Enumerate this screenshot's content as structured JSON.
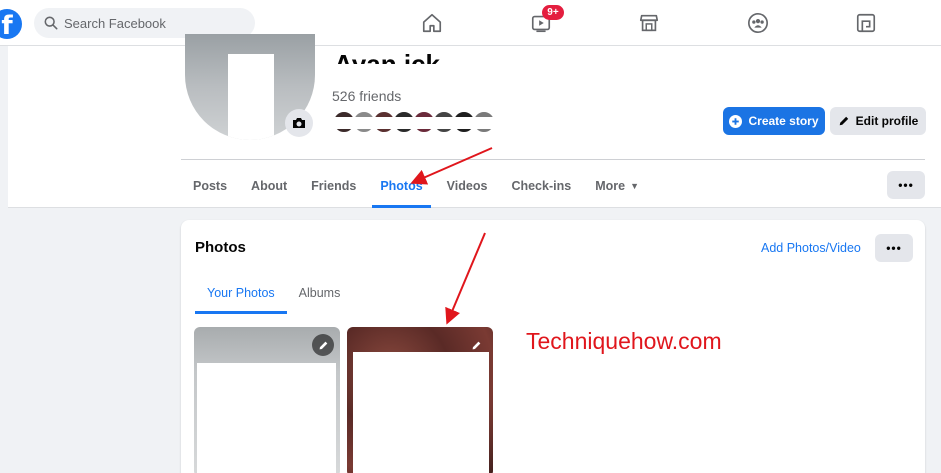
{
  "topbar": {
    "logo_letter": "f",
    "search": {
      "placeholder": "Search Facebook",
      "value": ""
    },
    "nav": [
      {
        "name": "home-icon"
      },
      {
        "name": "watch-icon",
        "badge": "9+"
      },
      {
        "name": "marketplace-icon"
      },
      {
        "name": "groups-icon"
      },
      {
        "name": "gaming-icon"
      }
    ]
  },
  "profile": {
    "name": "Ayan     ick",
    "friends_count": "526 friends",
    "create_story_label": "Create story",
    "edit_profile_label": "Edit profile",
    "more_label": "•••"
  },
  "tabs": [
    {
      "label": "Posts"
    },
    {
      "label": "About"
    },
    {
      "label": "Friends"
    },
    {
      "label": "Photos",
      "active": true
    },
    {
      "label": "Videos"
    },
    {
      "label": "Check-ins"
    },
    {
      "label": "More"
    }
  ],
  "photos": {
    "title": "Photos",
    "add_label": "Add Photos/Video",
    "more_label": "•••",
    "subtabs": [
      {
        "label": "Your Photos",
        "active": true
      },
      {
        "label": "Albums"
      }
    ]
  },
  "watermark": "Techniquehow.com",
  "colors": {
    "accent": "#1877f2",
    "annotation": "#e0161c",
    "badge": "#e41e3f"
  }
}
